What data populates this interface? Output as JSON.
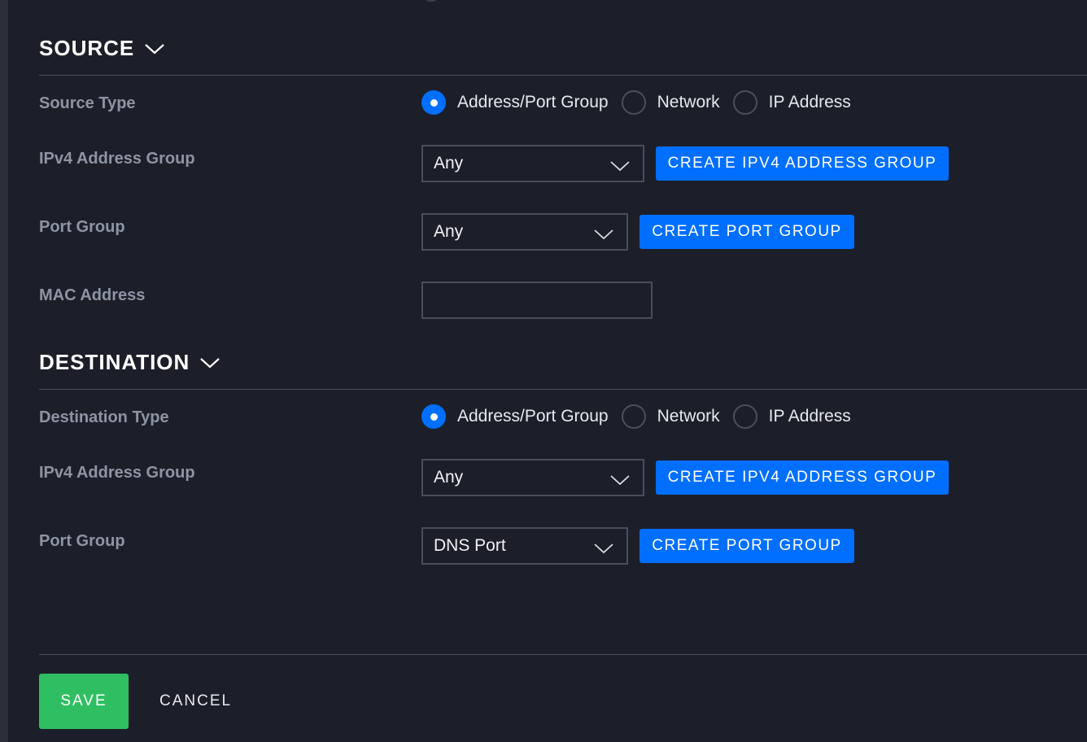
{
  "source": {
    "title": "SOURCE",
    "type_label": "Source Type",
    "type_options": [
      {
        "label": "Address/Port Group",
        "selected": true
      },
      {
        "label": "Network",
        "selected": false
      },
      {
        "label": "IP Address",
        "selected": false
      }
    ],
    "ipv4_group_label": "IPv4 Address Group",
    "ipv4_group_value": "Any",
    "create_ipv4_group_label": "CREATE IPV4 ADDRESS GROUP",
    "port_group_label": "Port Group",
    "port_group_value": "Any",
    "create_port_group_label": "CREATE PORT GROUP",
    "mac_address_label": "MAC Address",
    "mac_address_value": ""
  },
  "destination": {
    "title": "DESTINATION",
    "type_label": "Destination Type",
    "type_options": [
      {
        "label": "Address/Port Group",
        "selected": true
      },
      {
        "label": "Network",
        "selected": false
      },
      {
        "label": "IP Address",
        "selected": false
      }
    ],
    "ipv4_group_label": "IPv4 Address Group",
    "ipv4_group_value": "Any",
    "create_ipv4_group_label": "CREATE IPV4 ADDRESS GROUP",
    "port_group_label": "Port Group",
    "port_group_value": "DNS Port",
    "create_port_group_label": "CREATE PORT GROUP"
  },
  "footer": {
    "save_label": "SAVE",
    "cancel_label": "CANCEL"
  },
  "colors": {
    "background": "#1c1f2a",
    "primary": "#006fff",
    "save": "#2fbf62",
    "label": "#8e94a3",
    "border": "#4a4e5c"
  },
  "icons": {
    "section_toggle": "chevron-down-icon",
    "select_arrow": "chevron-down-icon"
  }
}
